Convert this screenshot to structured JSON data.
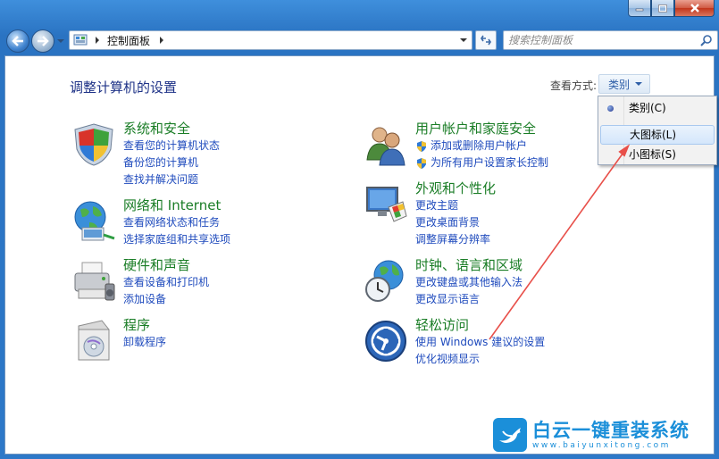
{
  "window": {
    "accent": "#2a78c8"
  },
  "address_bar": {
    "path": "控制面板"
  },
  "search": {
    "placeholder": "搜索控制面板"
  },
  "main": {
    "title": "调整计算机的设置",
    "view_by_label": "查看方式:",
    "view_by_value": "类别"
  },
  "categories": [
    {
      "title": "系统和安全",
      "icon": "shield-flag-icon",
      "links": [
        "查看您的计算机状态",
        "备份您的计算机",
        "查找并解决问题"
      ]
    },
    {
      "title": "网络和 Internet",
      "icon": "network-globe-icon",
      "links": [
        "查看网络状态和任务",
        "选择家庭组和共享选项"
      ]
    },
    {
      "title": "硬件和声音",
      "icon": "printer-icon",
      "links": [
        "查看设备和打印机",
        "添加设备"
      ]
    },
    {
      "title": "程序",
      "icon": "programs-box-icon",
      "links": [
        "卸载程序"
      ]
    },
    {
      "title": "用户帐户和家庭安全",
      "icon": "users-icon",
      "links": [
        "添加或删除用户帐户",
        "为所有用户设置家长控制"
      ]
    },
    {
      "title": "外观和个性化",
      "icon": "monitor-palette-icon",
      "links": [
        "更改主题",
        "更改桌面背景",
        "调整屏幕分辨率"
      ]
    },
    {
      "title": "时钟、语言和区域",
      "icon": "globe-clock-icon",
      "links": [
        "更改键盘或其他输入法",
        "更改显示语言"
      ]
    },
    {
      "title": "轻松访问",
      "icon": "ease-of-access-icon",
      "links": [
        "使用 Windows 建议的设置",
        "优化视频显示"
      ]
    }
  ],
  "view_menu": {
    "items": [
      "类别(C)",
      "大图标(L)",
      "小图标(S)"
    ],
    "selected": "类别(C)",
    "highlighted": "大图标(L)"
  },
  "watermark": {
    "name": "白云一键重装系统",
    "url": "www.baiyunxitong.com"
  }
}
